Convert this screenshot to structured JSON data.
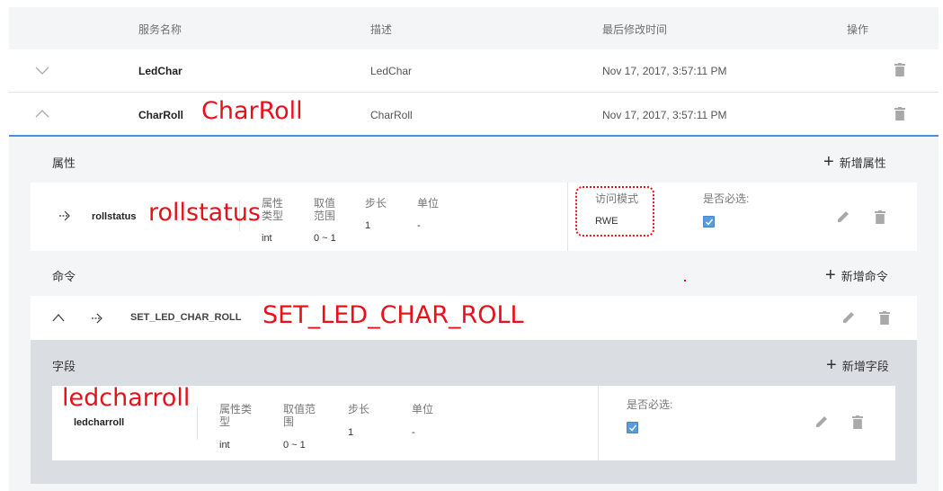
{
  "header": {
    "col_name": "服务名称",
    "col_desc": "描述",
    "col_time": "最后修改时间",
    "col_ops": "操作"
  },
  "rows": [
    {
      "name": "LedChar",
      "desc": "LedChar",
      "time": "Nov 17, 2017, 3:57:11 PM"
    },
    {
      "name": "CharRoll",
      "desc": "CharRoll",
      "time": "Nov 17, 2017, 3:57:11 PM"
    }
  ],
  "details": {
    "attr_section": "属性",
    "add_attr": "新增属性",
    "attr_item": {
      "name": "rollstatus",
      "type_label": "属性类型",
      "type_value": "int",
      "range_label": "取值范围",
      "range_value": "0 ~ 1",
      "step_label": "步长",
      "step_value": "1",
      "unit_label": "单位",
      "unit_value": "-",
      "access_label": "访问模式",
      "access_value": "RWE",
      "required_label": "是否必选:",
      "required": true
    },
    "cmd_section": "命令",
    "add_cmd": "新增命令",
    "cmd_item": {
      "name": "SET_LED_CHAR_ROLL"
    },
    "field_section": "字段",
    "add_field": "新增字段",
    "field_item": {
      "name": "ledcharroll",
      "type_label": "属性类型",
      "type_value": "int",
      "range_label": "取值范围",
      "range_value": "0 ~ 1",
      "step_label": "步长",
      "step_value": "1",
      "unit_label": "单位",
      "unit_value": "-",
      "required_label": "是否必选:",
      "required": true
    }
  },
  "annotations": {
    "charroll": "CharRoll",
    "rollstatus": "rollstatus",
    "set_led_char_roll": "SET_LED_CHAR_ROLL",
    "ledcharroll": "ledcharroll"
  },
  "colors": {
    "accent": "#4a8fdc",
    "annotation": "#e8101a",
    "checkbox": "#5b9bdd"
  }
}
